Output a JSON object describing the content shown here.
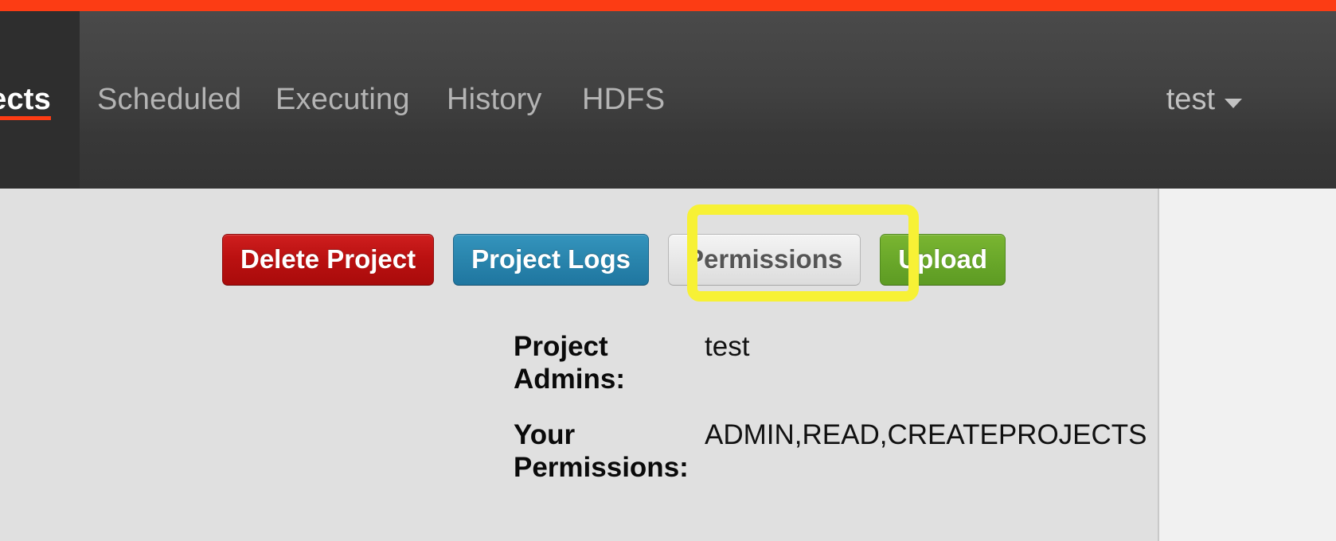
{
  "theme": {
    "accent_orange": "#fc3c14",
    "navbar_dark": "#414141",
    "active_tab_dark": "#2e2e2e",
    "panel_gray": "#e0e0e0",
    "page_gray": "#f1f1f1",
    "highlight_yellow": "#f7f135",
    "danger_red": "#bb1111",
    "info_blue": "#2a86ae",
    "success_green": "#6aa82a",
    "default_gray": "#e8e8e8"
  },
  "navbar": {
    "tabs": [
      {
        "label": "ects",
        "full_label": "Projects",
        "active": true,
        "clipped": true
      },
      {
        "label": "Scheduled",
        "active": false
      },
      {
        "label": "Executing",
        "active": false
      },
      {
        "label": "History",
        "active": false
      },
      {
        "label": "HDFS",
        "active": false
      }
    ],
    "user": {
      "name": "test",
      "caret_icon": "chevron-down-icon"
    }
  },
  "toolbar": {
    "buttons": [
      {
        "label": "Delete Project",
        "style": "danger"
      },
      {
        "label": "Project Logs",
        "style": "info"
      },
      {
        "label": "Permissions",
        "style": "default",
        "highlighted": true
      },
      {
        "label": "Upload",
        "style": "success"
      }
    ]
  },
  "project_info": {
    "rows": [
      {
        "label": "Project Admins:",
        "value": "test"
      },
      {
        "label": "Your Permissions:",
        "value": "ADMIN,READ,CREATEPROJECTS"
      }
    ]
  }
}
